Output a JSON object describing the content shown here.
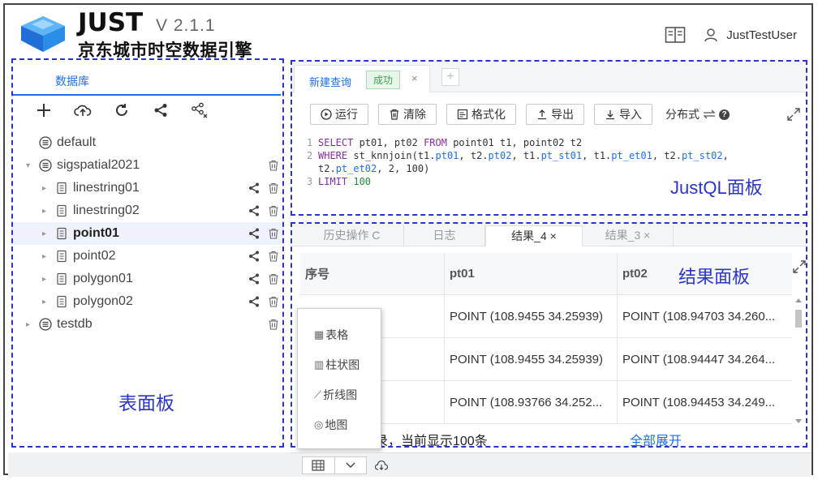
{
  "header": {
    "app_name": "JUST",
    "version": "V 2.1.1",
    "subtitle": "京东城市时空数据引擎",
    "username": "JustTestUser"
  },
  "left_panel": {
    "tab_label": "数据库",
    "caption": "表面板",
    "toolbar": [
      {
        "name": "add-icon"
      },
      {
        "name": "cloud-upload-icon"
      },
      {
        "name": "refresh-icon"
      },
      {
        "name": "share-icon"
      },
      {
        "name": "unshare-icon"
      }
    ],
    "tree": [
      {
        "label": "default",
        "level": 0,
        "type": "db",
        "caret": "",
        "selected": false,
        "actions": []
      },
      {
        "label": "sigspatial2021",
        "level": 0,
        "type": "db",
        "caret": "▾",
        "selected": false,
        "actions": [
          "delete"
        ]
      },
      {
        "label": "linestring01",
        "level": 1,
        "type": "table",
        "caret": "▸",
        "selected": false,
        "actions": [
          "share",
          "delete"
        ]
      },
      {
        "label": "linestring02",
        "level": 1,
        "type": "table",
        "caret": "▸",
        "selected": false,
        "actions": [
          "share",
          "delete"
        ]
      },
      {
        "label": "point01",
        "level": 1,
        "type": "table",
        "caret": "▸",
        "selected": true,
        "actions": [
          "share",
          "delete"
        ]
      },
      {
        "label": "point02",
        "level": 1,
        "type": "table",
        "caret": "▸",
        "selected": false,
        "actions": [
          "share",
          "delete"
        ]
      },
      {
        "label": "polygon01",
        "level": 1,
        "type": "table",
        "caret": "▸",
        "selected": false,
        "actions": [
          "share",
          "delete"
        ]
      },
      {
        "label": "polygon02",
        "level": 1,
        "type": "table",
        "caret": "▸",
        "selected": false,
        "actions": [
          "share",
          "delete"
        ]
      },
      {
        "label": "testdb",
        "level": 0,
        "type": "db",
        "caret": "▸",
        "selected": false,
        "actions": [
          "delete"
        ]
      }
    ]
  },
  "query_panel": {
    "tab_title": "新建查询",
    "tab_status": "成功",
    "close": "×",
    "add": "+",
    "buttons": {
      "run": "运行",
      "clear": "清除",
      "format": "格式化",
      "export": "导出",
      "import": "导入"
    },
    "distributed_label": "分布式",
    "caption": "JustQL面板",
    "code_lines": [
      {
        "n": "1",
        "html": "<span class='kw'>SELECT</span> pt01, pt02 <span class='kw'>FROM</span> point01 t1, point02 t2"
      },
      {
        "n": "2",
        "html": "<span class='kw'>WHERE</span> st_knnjoin(t1.<span class='fld'>pt01</span>, t2.<span class='fld'>pt02</span>, t1.<span class='fld'>pt_st01</span>, t1.<span class='fld'>pt_et01</span>, t2.<span class='fld'>pt_st02</span>,"
      },
      {
        "n": "",
        "html": "t2.<span class='fld'>pt_et02</span>, 2, 100)"
      },
      {
        "n": "3",
        "html": "<span class='kw'>LIMIT</span> <span class='num'>100</span>"
      }
    ]
  },
  "result_panel": {
    "tabs": [
      {
        "label": "历史操作 C",
        "active": false
      },
      {
        "label": "日志",
        "active": false
      },
      {
        "label": "结果_4 ×",
        "active": true
      },
      {
        "label": "结果_3 ×",
        "active": false
      }
    ],
    "caption": "结果面板",
    "columns": [
      "序号",
      "pt01",
      "pt02"
    ],
    "rows": [
      {
        "idx": "",
        "pt01": "POINT (108.9455 34.25939)",
        "pt02": "POINT (108.94703 34.260..."
      },
      {
        "idx": "",
        "pt01": "POINT (108.9455 34.25939)",
        "pt02": "POINT (108.94447 34.264..."
      },
      {
        "idx": "",
        "pt01": "POINT (108.93766 34.252...",
        "pt02": "POINT (108.94453 34.249..."
      }
    ],
    "view_menu": [
      {
        "icon": "▦",
        "label": "表格",
        "name": "table-view-option"
      },
      {
        "icon": "▥",
        "label": "柱状图",
        "name": "bar-chart-option"
      },
      {
        "icon": "⟋",
        "label": "折线图",
        "name": "line-chart-option"
      },
      {
        "icon": "◎",
        "label": "地图",
        "name": "map-option"
      }
    ],
    "footer_left": "录，当前显示100条",
    "footer_right": "全部展开"
  },
  "colors": {
    "accent": "#1d6fe8",
    "annotation": "#2b35c9",
    "success": "#3aa34a"
  }
}
